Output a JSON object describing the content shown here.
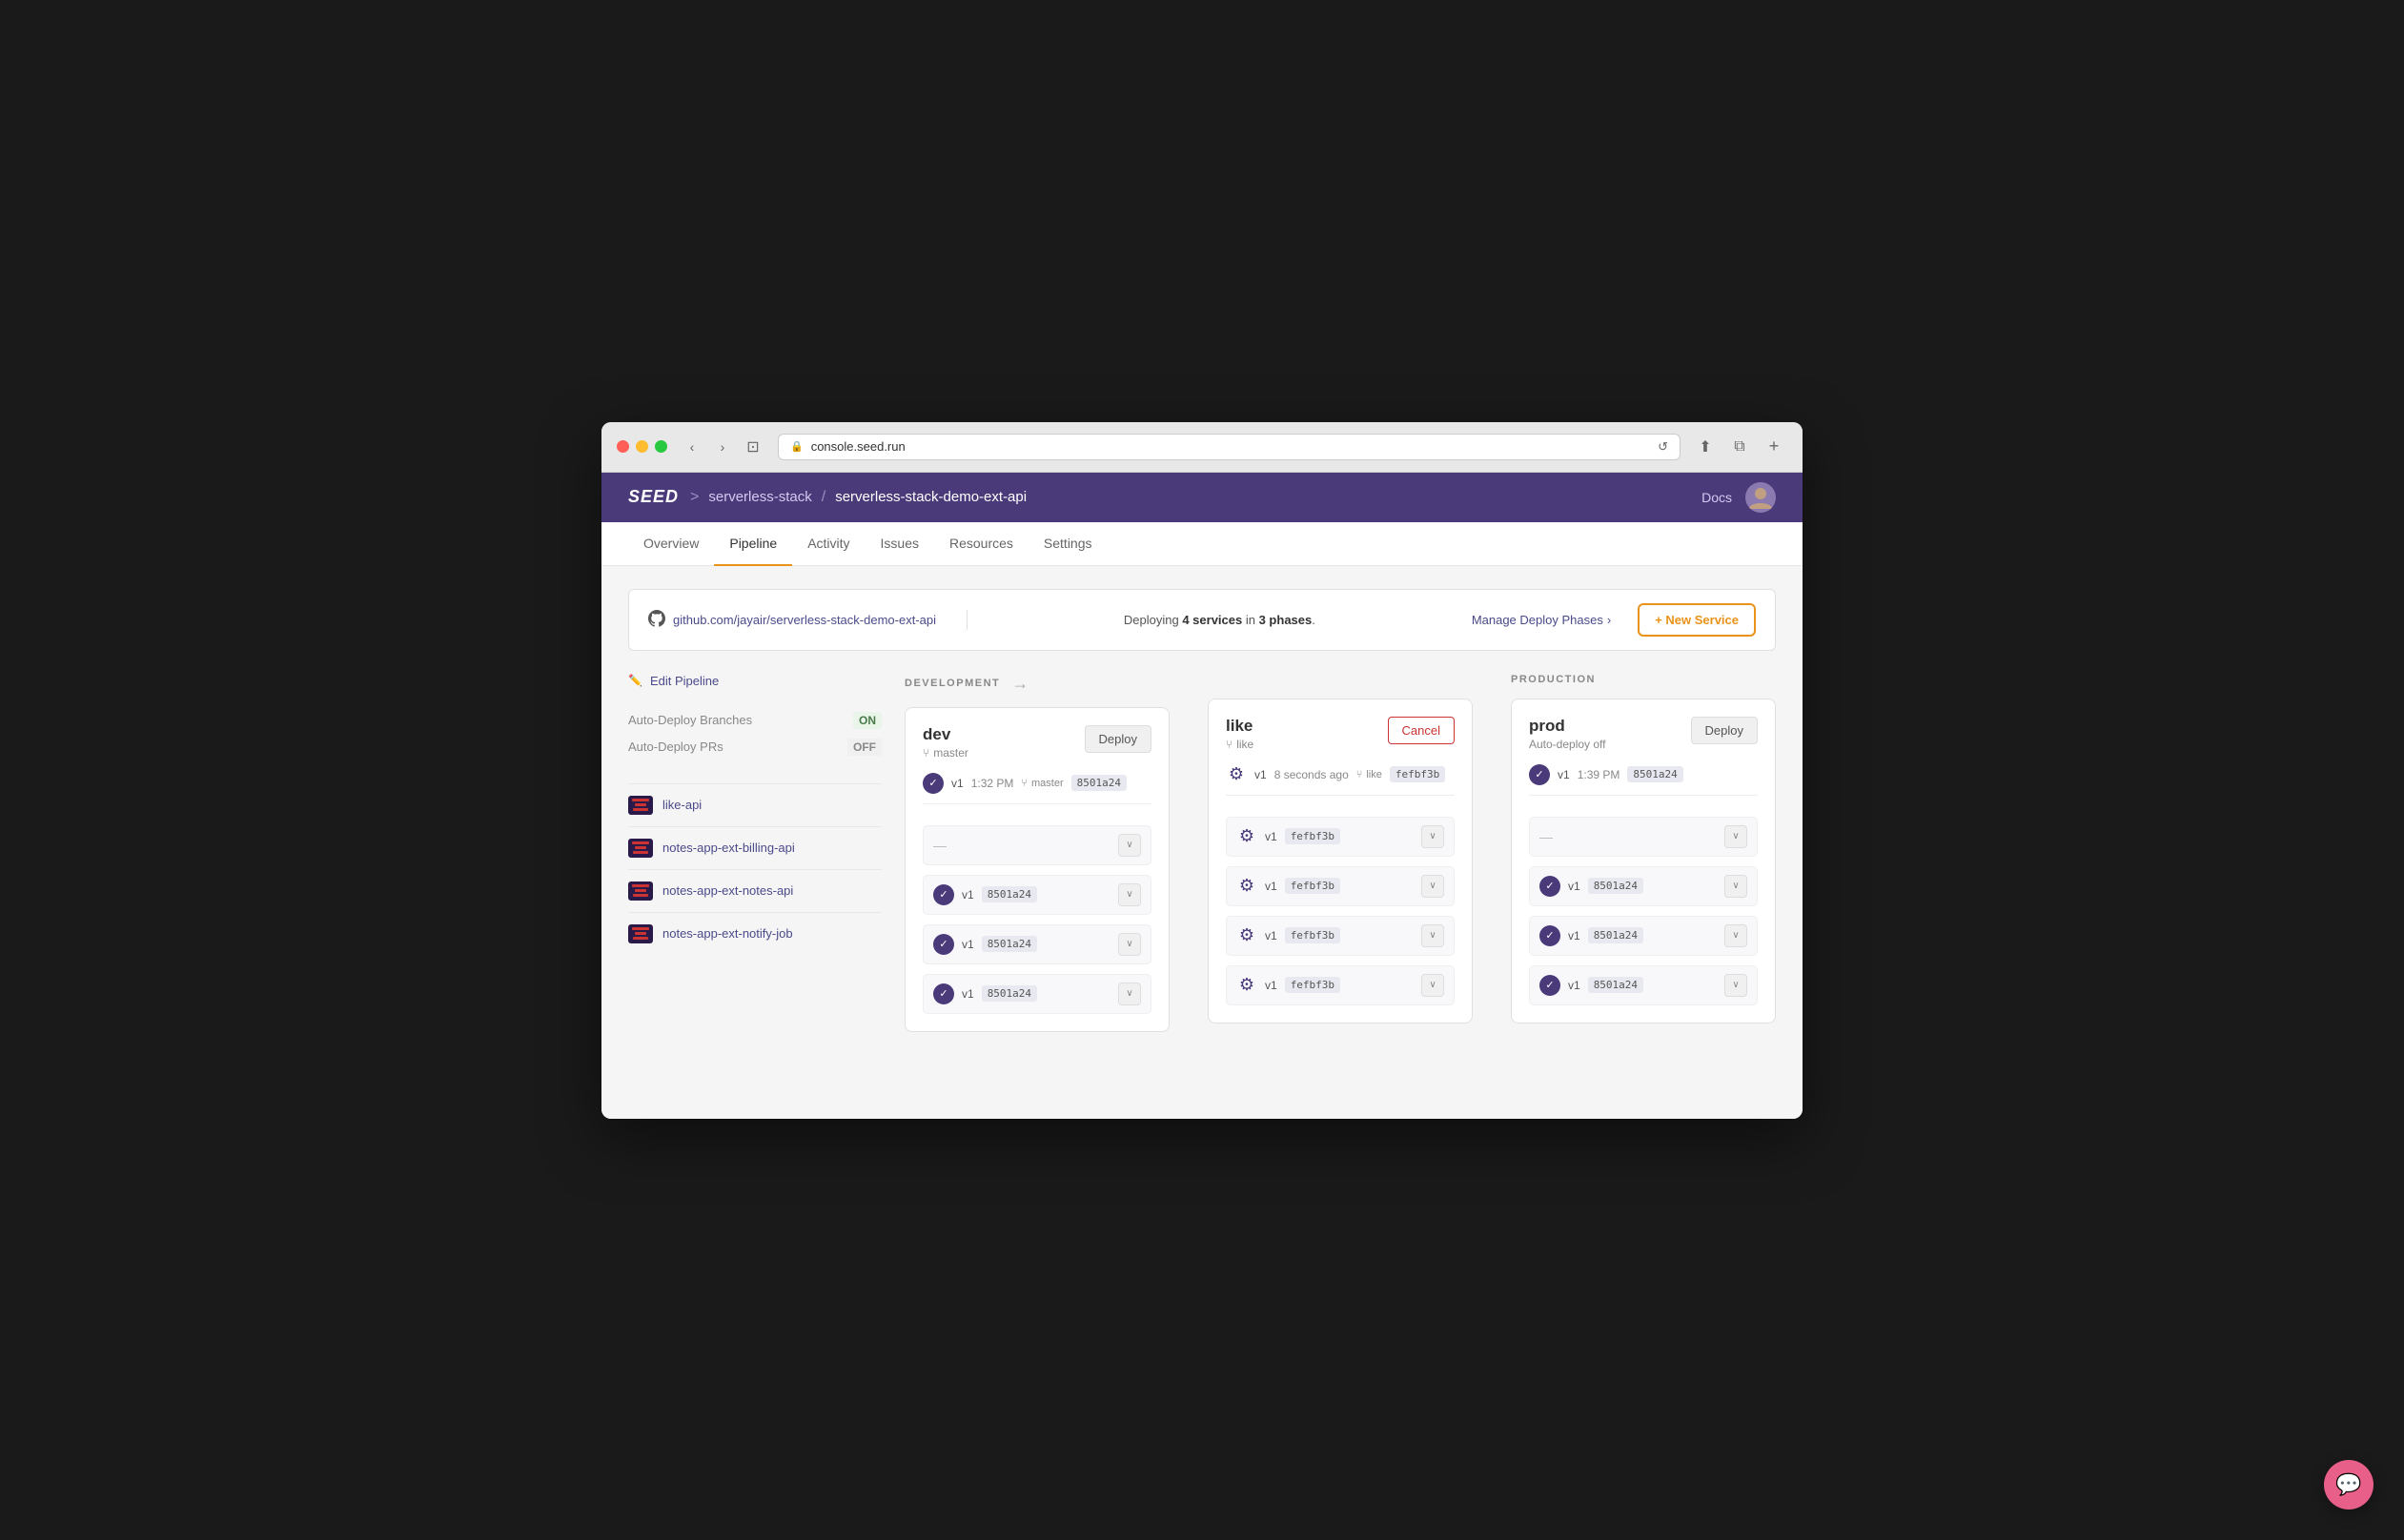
{
  "browser": {
    "url": "console.seed.run",
    "back_label": "‹",
    "forward_label": "›",
    "sidebar_label": "⊞",
    "refresh_label": "↺"
  },
  "app": {
    "logo": "SEED",
    "breadcrumb_sep": ">",
    "org": "serverless-stack",
    "sep2": "/",
    "app_name": "serverless-stack-demo-ext-api",
    "docs_label": "Docs"
  },
  "nav": {
    "tabs": [
      "Overview",
      "Pipeline",
      "Activity",
      "Issues",
      "Resources",
      "Settings"
    ],
    "active_tab": "Pipeline"
  },
  "info_bar": {
    "repo": "github.com/jayair/serverless-stack-demo-ext-api",
    "deploy_text_1": "Deploying ",
    "deploy_count": "4 services",
    "deploy_text_2": " in ",
    "phase_count": "3 phases",
    "deploy_text_3": ".",
    "manage_label": "Manage Deploy Phases",
    "new_service_label": "+ New Service"
  },
  "sidebar": {
    "edit_pipeline_label": "Edit Pipeline",
    "auto_deploy_branches_label": "Auto-Deploy Branches",
    "auto_deploy_branches_value": "ON",
    "auto_deploy_prs_label": "Auto-Deploy PRs",
    "auto_deploy_prs_value": "OFF",
    "services": [
      {
        "name": "like-api"
      },
      {
        "name": "notes-app-ext-billing-api"
      },
      {
        "name": "notes-app-ext-notes-api"
      },
      {
        "name": "notes-app-ext-notify-job"
      }
    ]
  },
  "pipeline": {
    "development_label": "DEVELOPMENT",
    "production_label": "PRODUCTION",
    "stages": [
      {
        "id": "dev",
        "name": "dev",
        "branch": "master",
        "button": "Deploy",
        "button_type": "deploy",
        "top_row": {
          "version": "v1",
          "time": "1:32 PM",
          "branch_commit": "master",
          "commit_hash": "8501a24",
          "status": "check"
        },
        "rows": [
          {
            "type": "dash"
          },
          {
            "type": "check",
            "version": "v1",
            "commit_hash": "8501a24"
          },
          {
            "type": "check",
            "version": "v1",
            "commit_hash": "8501a24"
          },
          {
            "type": "check",
            "version": "v1",
            "commit_hash": "8501a24"
          }
        ]
      },
      {
        "id": "like",
        "name": "like",
        "branch": "like",
        "button": "Cancel",
        "button_type": "cancel",
        "top_row": {
          "version": "v1",
          "time": "8 seconds ago",
          "branch_commit": "like",
          "commit_hash": "fefbf3b",
          "status": "gear"
        },
        "rows": [
          {
            "type": "gear",
            "version": "v1",
            "commit_hash": "fefbf3b"
          },
          {
            "type": "gear",
            "version": "v1",
            "commit_hash": "fefbf3b"
          },
          {
            "type": "gear",
            "version": "v1",
            "commit_hash": "fefbf3b"
          },
          {
            "type": "gear",
            "version": "v1",
            "commit_hash": "fefbf3b"
          }
        ]
      },
      {
        "id": "prod",
        "name": "prod",
        "branch": "Auto-deploy off",
        "button": "Deploy",
        "button_type": "deploy",
        "top_row": {
          "version": "v1",
          "time": "1:39 PM",
          "commit_hash": "8501a24",
          "status": "check"
        },
        "rows": [
          {
            "type": "dash"
          },
          {
            "type": "check",
            "version": "v1",
            "commit_hash": "8501a24"
          },
          {
            "type": "check",
            "version": "v1",
            "commit_hash": "8501a24"
          },
          {
            "type": "check",
            "version": "v1",
            "commit_hash": "8501a24"
          }
        ]
      }
    ]
  },
  "chat": {
    "icon": "💬"
  }
}
